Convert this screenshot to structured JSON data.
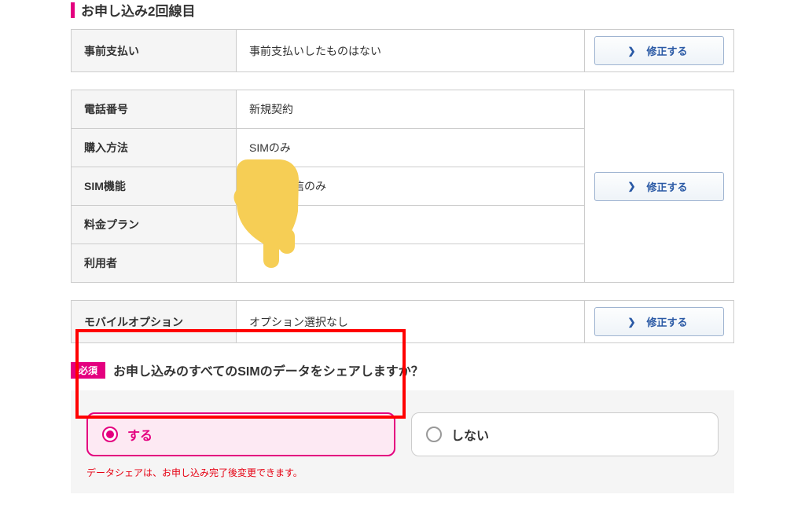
{
  "section": {
    "title": "お申し込み2回線目"
  },
  "table1": {
    "rows": [
      {
        "label": "事前支払い",
        "value": "事前支払いしたものはない"
      }
    ],
    "edit": "修正する"
  },
  "table2": {
    "rows": [
      {
        "label": "電話番号",
        "value": "新規契約"
      },
      {
        "label": "購入方法",
        "value": "SIMのみ"
      },
      {
        "label": "SIM機能",
        "value": "データ通信のみ"
      },
      {
        "label": "料金プラン",
        "value": ""
      },
      {
        "label": "利用者",
        "value": ""
      }
    ],
    "edit": "修正する"
  },
  "table3": {
    "rows": [
      {
        "label": "モバイルオプション",
        "value": "オプション選択なし"
      }
    ],
    "edit": "修正する"
  },
  "question": {
    "required": "必須",
    "text": "お申し込みのすべてのSIMのデータをシェアしますか？",
    "options": {
      "yes": "する",
      "no": "しない"
    },
    "hint": "データシェアは、お申し込み完了後変更できます。"
  }
}
